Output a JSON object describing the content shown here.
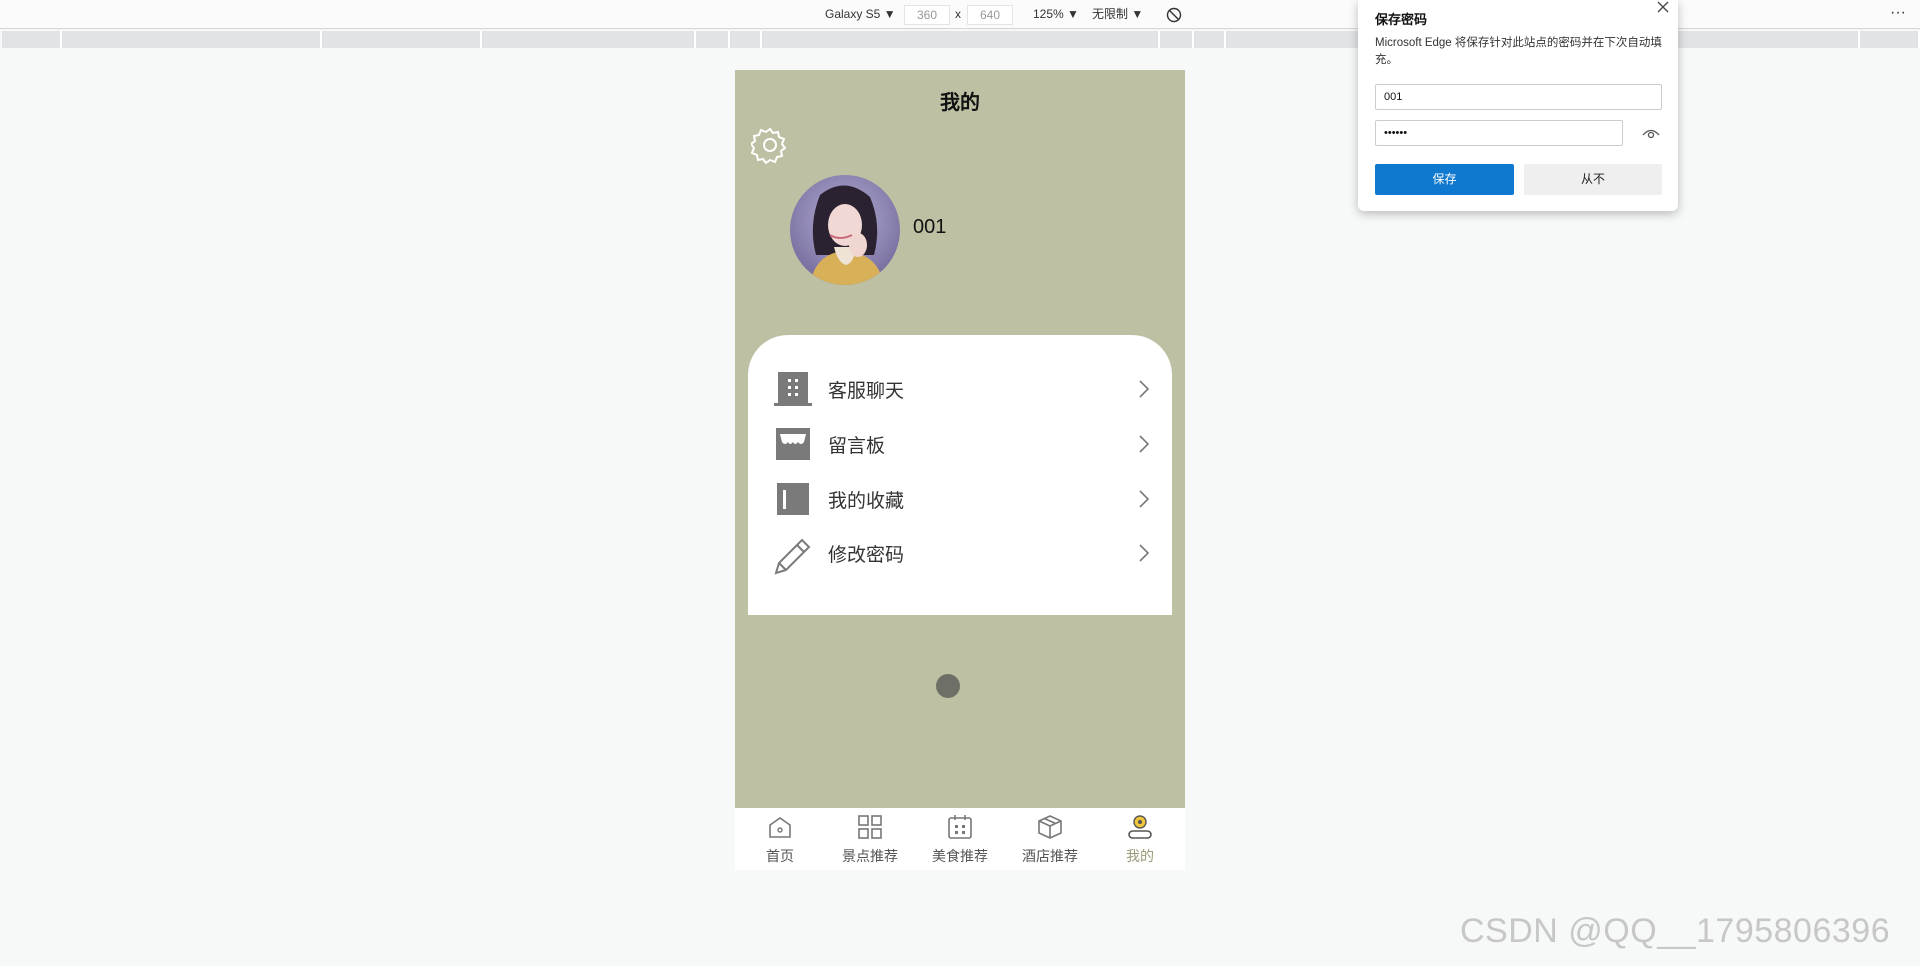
{
  "devtools": {
    "device": "Galaxy S5 ▼",
    "width": "360",
    "times": "x",
    "height": "640",
    "zoom": "125% ▼",
    "throttle": "无限制 ▼",
    "more": "···"
  },
  "phone": {
    "title": "我的",
    "username": "001",
    "menu": [
      {
        "label": "客服聊天",
        "icon": "building-icon"
      },
      {
        "label": "留言板",
        "icon": "store-icon"
      },
      {
        "label": "我的收藏",
        "icon": "bookmark-icon"
      },
      {
        "label": "修改密码",
        "icon": "pencil-icon"
      }
    ],
    "tabs": [
      {
        "label": "首页",
        "icon": "home-icon"
      },
      {
        "label": "景点推荐",
        "icon": "grid-icon"
      },
      {
        "label": "美食推荐",
        "icon": "calendar-icon"
      },
      {
        "label": "酒店推荐",
        "icon": "cube-icon"
      },
      {
        "label": "我的",
        "icon": "user-icon"
      }
    ],
    "background_color": "#bec0a4"
  },
  "popup": {
    "title": "保存密码",
    "description": "Microsoft Edge 将保存针对此站点的密码并在下次自动填充。",
    "username_value": "001",
    "password_value": "••••••",
    "save_label": "保存",
    "never_label": "从不",
    "accent_color": "#0f79d0"
  },
  "watermark": "CSDN @QQ__1795806396"
}
